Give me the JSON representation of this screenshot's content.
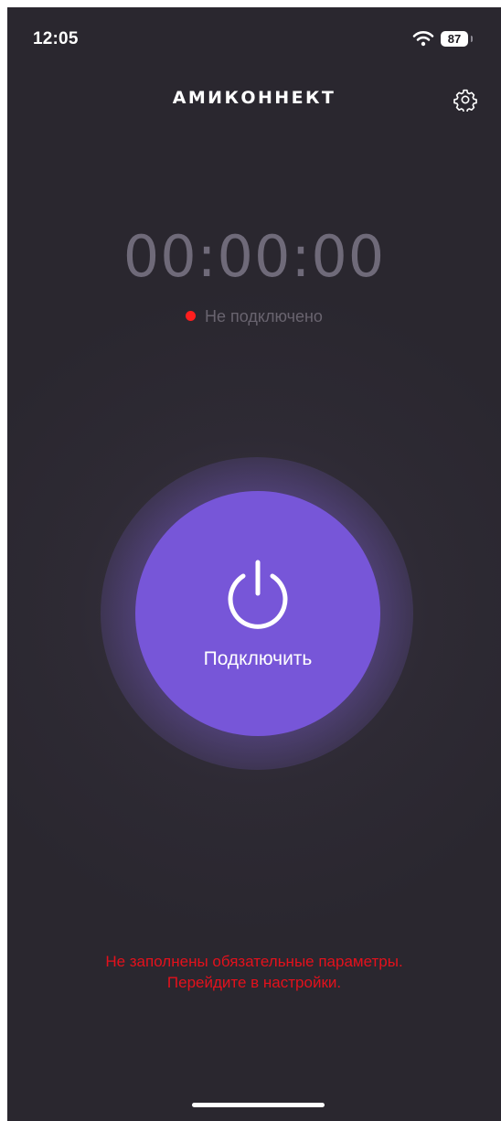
{
  "status_bar": {
    "time": "12:05",
    "battery_level": "87",
    "wifi_icon": "wifi-icon"
  },
  "header": {
    "title": "АМИКОННЕКТ",
    "settings_icon": "gear-icon"
  },
  "timer": {
    "value": "00:00:00"
  },
  "connection": {
    "status_text": "Не подключено",
    "status_color": "#ff1e1e"
  },
  "connect_button": {
    "icon": "power-icon",
    "label": "Подключить",
    "color": "#7756d8"
  },
  "error": {
    "line1": "Не заполнены обязательные параметры.",
    "line2": "Перейдите в настройки.",
    "color": "#e4111c"
  }
}
